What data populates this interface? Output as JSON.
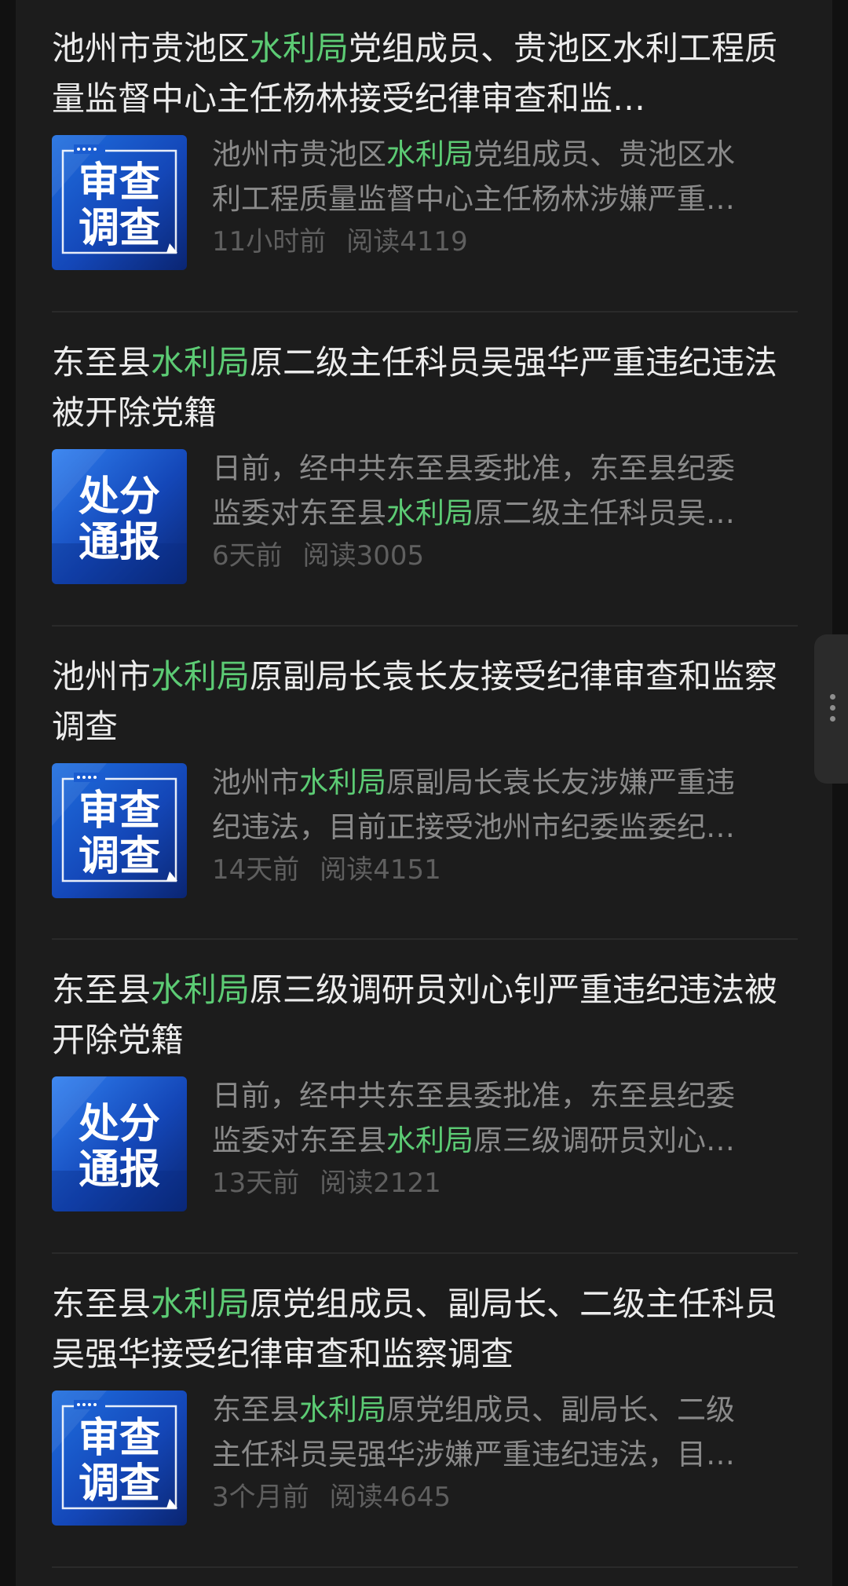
{
  "colors": {
    "highlight": "#5ccb74",
    "background": "#1c1c1c",
    "title": "#ececec",
    "snippet": "#8a8a8a",
    "meta": "#5f5f5f"
  },
  "articles": [
    {
      "title_pre": "池州市贵池区",
      "title_hl": "水利局",
      "title_post": "党组成员、贵池区水利工程质量监督中心主任杨林接受纪律审查和监…",
      "thumb": {
        "type": "review",
        "line1": "审查",
        "line2": "调查"
      },
      "snippet1_pre": "池州市贵池区",
      "snippet1_hl": "水利局",
      "snippet1_post": "党组成员、贵池区水",
      "snippet2_pre": "利工程质量监督中心主任杨林涉嫌严重…",
      "snippet2_hl": "",
      "snippet2_post": "",
      "time": "11小时前",
      "reads": "阅读4119"
    },
    {
      "title_pre": "东至县",
      "title_hl": "水利局",
      "title_post": "原二级主任科员吴强华严重违纪违法被开除党籍",
      "thumb": {
        "type": "punish",
        "line1": "处分",
        "line2": "通报"
      },
      "snippet1_pre": "日前，经中共东至县委批准，东至县纪委",
      "snippet1_hl": "",
      "snippet1_post": "",
      "snippet2_pre": "监委对东至县",
      "snippet2_hl": "水利局",
      "snippet2_post": "原二级主任科员吴…",
      "time": "6天前",
      "reads": "阅读3005"
    },
    {
      "title_pre": "池州市",
      "title_hl": "水利局",
      "title_post": "原副局长袁长友接受纪律审查和监察调查",
      "thumb": {
        "type": "review",
        "line1": "审查",
        "line2": "调查"
      },
      "snippet1_pre": "池州市",
      "snippet1_hl": "水利局",
      "snippet1_post": "原副局长袁长友涉嫌严重违",
      "snippet2_pre": "纪违法，目前正接受池州市纪委监委纪…",
      "snippet2_hl": "",
      "snippet2_post": "",
      "time": "14天前",
      "reads": "阅读4151"
    },
    {
      "title_pre": "东至县",
      "title_hl": "水利局",
      "title_post": "原三级调研员刘心钊严重违纪违法被开除党籍",
      "thumb": {
        "type": "punish",
        "line1": "处分",
        "line2": "通报"
      },
      "snippet1_pre": "日前，经中共东至县委批准，东至县纪委",
      "snippet1_hl": "",
      "snippet1_post": "",
      "snippet2_pre": "监委对东至县",
      "snippet2_hl": "水利局",
      "snippet2_post": "原三级调研员刘心…",
      "time": "13天前",
      "reads": "阅读2121"
    },
    {
      "title_pre": "东至县",
      "title_hl": "水利局",
      "title_post": "原党组成员、副局长、二级主任科员吴强华接受纪律审查和监察调查",
      "thumb": {
        "type": "review",
        "line1": "审查",
        "line2": "调查"
      },
      "snippet1_pre": "东至县",
      "snippet1_hl": "水利局",
      "snippet1_post": "原党组成员、副局长、二级",
      "snippet2_pre": "主任科员吴强华涉嫌严重违纪违法，目…",
      "snippet2_hl": "",
      "snippet2_post": "",
      "time": "3个月前",
      "reads": "阅读4645"
    }
  ]
}
